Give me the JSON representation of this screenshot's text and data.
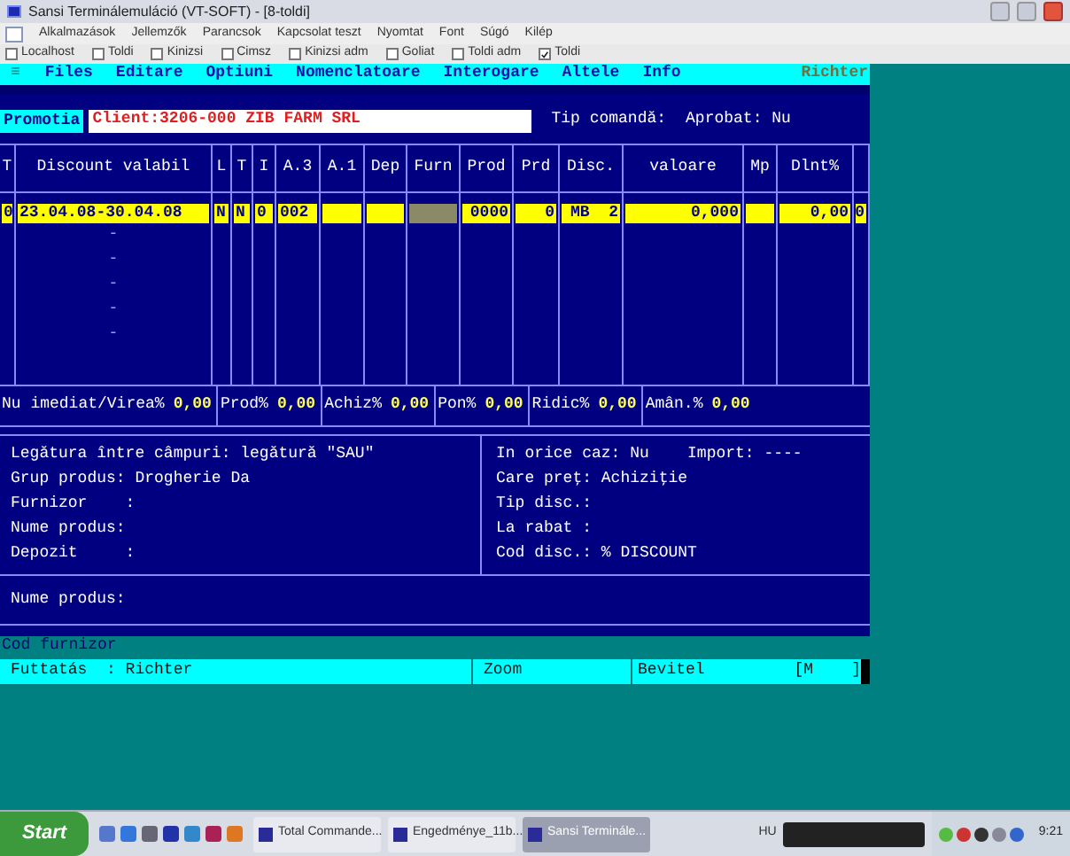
{
  "window": {
    "title": "Sansi Terminálemuláció (VT-SOFT) - [8-toldi]"
  },
  "menu": [
    "Alkalmazások",
    "Jellemzők",
    "Parancsok",
    "Kapcsolat teszt",
    "Nyomtat",
    "Font",
    "Súgó",
    "Kilép"
  ],
  "hosts": [
    {
      "label": "Localhost",
      "checked": false
    },
    {
      "label": "Toldi",
      "checked": false
    },
    {
      "label": "Kinizsi",
      "checked": false
    },
    {
      "label": "Cimsz",
      "checked": false
    },
    {
      "label": "Kinizsi adm",
      "checked": false
    },
    {
      "label": "Goliat",
      "checked": false
    },
    {
      "label": "Toldi adm",
      "checked": false
    },
    {
      "label": "Toldi",
      "checked": true
    }
  ],
  "terminal": {
    "menu": {
      "icon": "≡",
      "items": [
        "Files",
        "Editare",
        "Optiuni",
        "Nomenclatoare",
        "Interogare",
        "Altele",
        "Info"
      ],
      "user": "Richter"
    },
    "promo": {
      "button": "Promotia",
      "client": "Client:3206-000 ZIB FARM SRL",
      "order_type": "Tip comandă:",
      "approved": "Aprobat: Nu"
    },
    "table": {
      "columns": [
        "T",
        "Discount valabil",
        "L",
        "T",
        "I",
        "A.3",
        "A.1",
        "Dep",
        "Furn",
        "Prod",
        "Prd",
        "Disc.",
        "valoare",
        "Mp",
        "Dlnt%"
      ],
      "rows": [
        {
          "selected": true,
          "cells": [
            {
              "text": "0"
            },
            {
              "text": "23.04.08-30.04.08"
            },
            {
              "text": "N"
            },
            {
              "text": "N"
            },
            {
              "text": "0"
            },
            {
              "text": "002"
            },
            {
              "kind": "blank"
            },
            {
              "kind": "blank"
            },
            {
              "kind": "cursor"
            },
            {
              "text": "0000"
            },
            {
              "text": "0"
            },
            {
              "text": "MB  2"
            },
            {
              "text": "0,000"
            },
            {
              "kind": "blank"
            },
            {
              "text": "0,00"
            },
            {
              "text": "0"
            }
          ]
        }
      ],
      "empty_marks": [
        "-",
        "-",
        "-",
        "-",
        "-"
      ]
    },
    "totals": [
      {
        "label": "Nu imediat/Virea%",
        "value": "0,00"
      },
      {
        "label": "Prod%",
        "value": "0,00"
      },
      {
        "label": "Achiz%",
        "value": "0,00"
      },
      {
        "label": "Pon%",
        "value": "0,00"
      },
      {
        "label": "Ridic%",
        "value": "0,00"
      },
      {
        "label": "Amân.%",
        "value": "0,00"
      }
    ],
    "filters_left": [
      "Legătura între câmpuri: legătură \"SAU\"",
      "Grup produs: Drogherie Da",
      "Furnizor    :",
      "Nume produs:",
      "Depozit     :"
    ],
    "filters_right": [
      "In orice caz: Nu    Import: ----",
      "Care preţ: Achiziţie",
      "Tip disc.:",
      "La rabat :",
      "Cod disc.: % DISCOUNT"
    ],
    "product_name": "Nume produs:",
    "hint": "Cod furnizor",
    "status": {
      "user": "Futtatás  : Richter",
      "mode": "Zoom",
      "input": "Bevitel",
      "indicator": "[M    ]"
    }
  },
  "taskbar": {
    "start": "Start",
    "tasks": [
      {
        "label": "Total Commande...",
        "selected": false
      },
      {
        "label": "Engedménye_11b...",
        "selected": false
      },
      {
        "label": "Sansi Terminále...",
        "selected": true
      }
    ],
    "language": "HU",
    "clock": "9:21"
  }
}
